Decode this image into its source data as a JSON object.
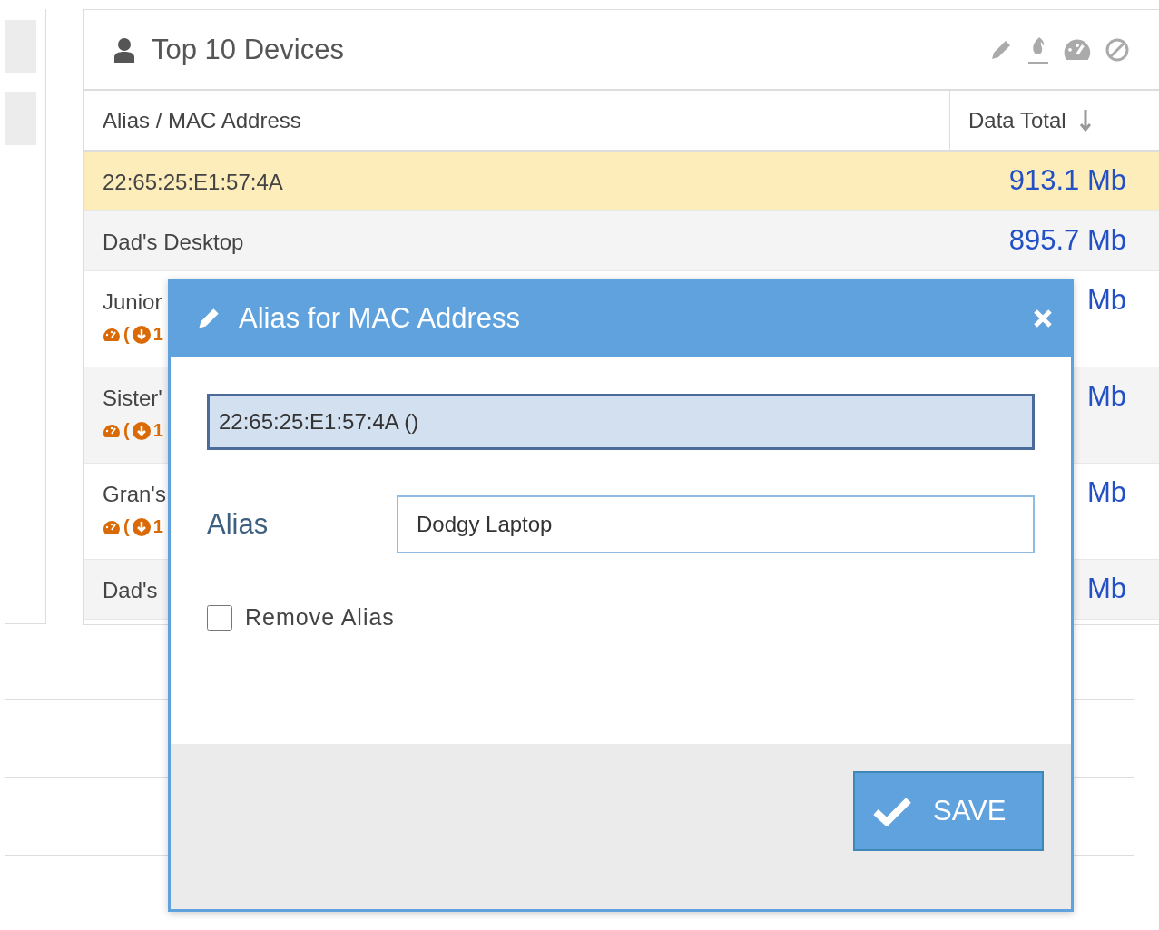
{
  "panel": {
    "title": "Top 10 Devices"
  },
  "table": {
    "columns": [
      {
        "label": "Alias / MAC Address",
        "sorted": false
      },
      {
        "label": "Data Total",
        "sorted": true
      }
    ],
    "rows": [
      {
        "name": "22:65:25:E1:57:4A",
        "total": "913.1 Mb",
        "highlighted": true,
        "sub": null
      },
      {
        "name": "Dad's Desktop",
        "total": "895.7 Mb",
        "highlighted": false,
        "sub": null
      },
      {
        "name": "Junior",
        "total": "Mb",
        "highlighted": false,
        "sub": {
          "paren": "(",
          "count": "1"
        }
      },
      {
        "name": "Sister'",
        "total": "Mb",
        "highlighted": false,
        "sub": {
          "paren": "(",
          "count": "1"
        }
      },
      {
        "name": "Gran's",
        "total": "Mb",
        "highlighted": false,
        "sub": {
          "paren": "(",
          "count": "1"
        }
      },
      {
        "name": "Dad's",
        "total": "Mb",
        "highlighted": false,
        "sub": null
      }
    ]
  },
  "dialog": {
    "title": "Alias for MAC Address",
    "mac_field": "22:65:25:E1:57:4A ()",
    "alias_label": "Alias",
    "alias_value": "Dodgy Laptop",
    "remove_alias": {
      "label": "Remove Alias",
      "checked": false
    },
    "save": "SAVE"
  }
}
